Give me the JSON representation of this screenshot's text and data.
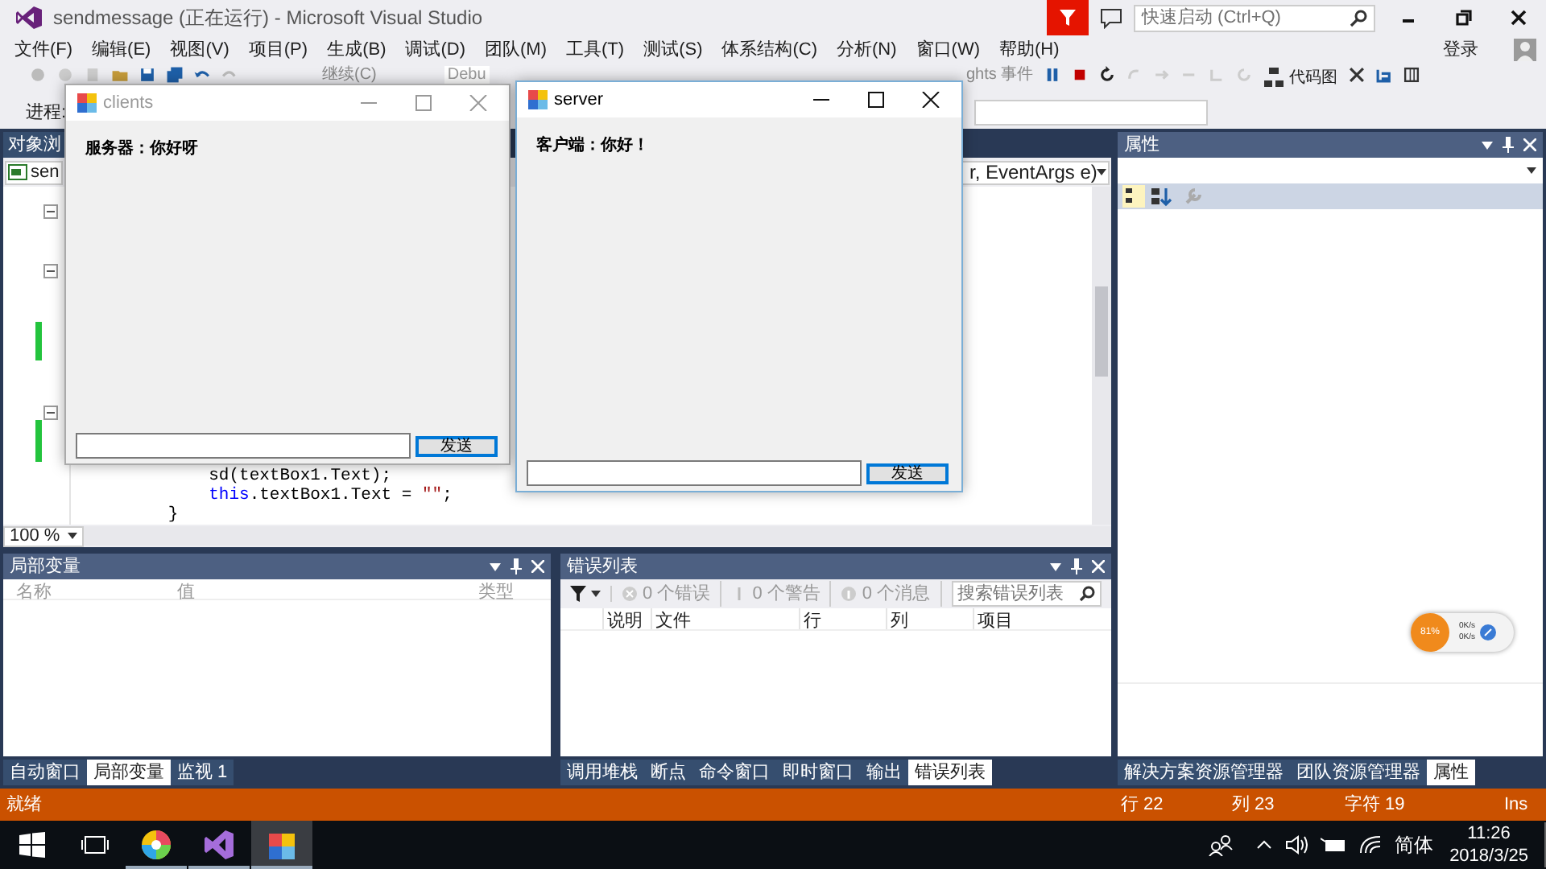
{
  "window": {
    "title": "sendmessage (正在运行) - Microsoft Visual Studio",
    "quick_launch_placeholder": "快速启动 (Ctrl+Q)"
  },
  "menu": [
    "文件(F)",
    "编辑(E)",
    "视图(V)",
    "项目(P)",
    "生成(B)",
    "调试(D)",
    "团队(M)",
    "工具(T)",
    "测试(S)",
    "体系结构(C)",
    "分析(N)",
    "窗口(W)",
    "帮助(H)"
  ],
  "account": "登录",
  "toolbar": {
    "continue": "继续(C)",
    "config": "Debu",
    "insights": "ghts 事件",
    "code_map": "代码图",
    "process_label": "进程:"
  },
  "document": {
    "tab": "对象浏",
    "nav_left": "sen",
    "nav_right": "r, EventArgs e)",
    "zoom": "100 %",
    "code_lines": [
      [
        {
          "kind": "plain",
          "text": "            sd(textBox1.Text);"
        }
      ],
      [
        {
          "kind": "keyword",
          "text": "            this"
        },
        {
          "kind": "plain",
          "text": ".textBox1.Text = "
        },
        {
          "kind": "string",
          "text": "\"\""
        },
        {
          "kind": "plain",
          "text": ";"
        }
      ],
      [
        {
          "kind": "plain",
          "text": "        }"
        }
      ]
    ]
  },
  "locals_panel": {
    "title": "局部变量",
    "columns": [
      "名称",
      "值",
      "类型"
    ],
    "tabs": [
      {
        "label": "自动窗口",
        "selected": false
      },
      {
        "label": "局部变量",
        "selected": true
      },
      {
        "label": "监视 1",
        "selected": false
      }
    ]
  },
  "error_list": {
    "title": "错误列表",
    "filters": [
      "0 个错误",
      "0 个警告",
      "0 个消息"
    ],
    "search_placeholder": "搜索错误列表",
    "columns": [
      "说明",
      "文件",
      "行",
      "列",
      "项目"
    ],
    "tabs": [
      {
        "label": "调用堆栈",
        "selected": false
      },
      {
        "label": "断点",
        "selected": false
      },
      {
        "label": "命令窗口",
        "selected": false
      },
      {
        "label": "即时窗口",
        "selected": false
      },
      {
        "label": "输出",
        "selected": false
      },
      {
        "label": "错误列表",
        "selected": true
      }
    ]
  },
  "properties_panel": {
    "title": "属性",
    "tabs": [
      {
        "label": "解决方案资源管理器",
        "selected": false
      },
      {
        "label": "团队资源管理器",
        "selected": false
      },
      {
        "label": "属性",
        "selected": true
      }
    ]
  },
  "status_bar": {
    "text": "就绪",
    "line": "行 22",
    "column": "列 23",
    "char": "字符 19",
    "mode": "Ins"
  },
  "speed_widget": {
    "percent": "81%",
    "upload": "0K/s",
    "download": "0K/s"
  },
  "app_windows": [
    {
      "title": "clients",
      "active": false,
      "message": "服务器：你好呀",
      "button": "发送"
    },
    {
      "title": "server",
      "active": true,
      "message": "客户端：你好！",
      "button": "发送"
    }
  ],
  "taskbar": {
    "apps": [
      {
        "kind": "paint",
        "selected": false
      },
      {
        "kind": "vs",
        "selected": false
      },
      {
        "kind": "form",
        "selected": true
      }
    ],
    "ime": "简体",
    "time": "11:26",
    "date": "2018/3/25"
  }
}
